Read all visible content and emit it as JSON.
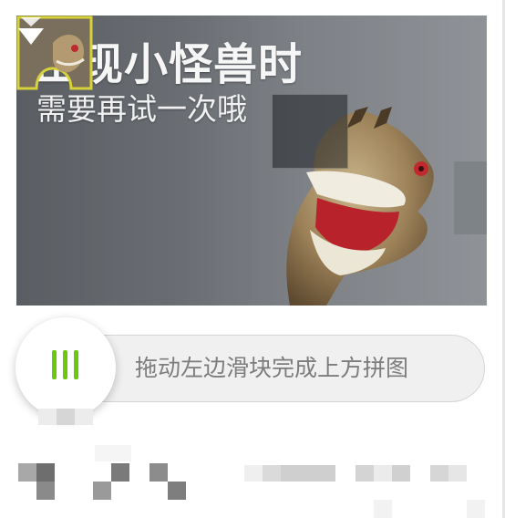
{
  "captcha": {
    "headline": "出现小怪兽时",
    "subline": "需要再试一次哦",
    "slider_hint": "拖动左边滑块完成上方拼图"
  },
  "icons": {
    "drop_indicator": "down-arrow-icon",
    "slider_grip": "grip-lines-icon"
  },
  "colors": {
    "accent_green": "#6cc80f",
    "piece_border": "#d8d23a",
    "track_bg": "#f0f0f0",
    "hint_text": "#7d7d7d"
  }
}
